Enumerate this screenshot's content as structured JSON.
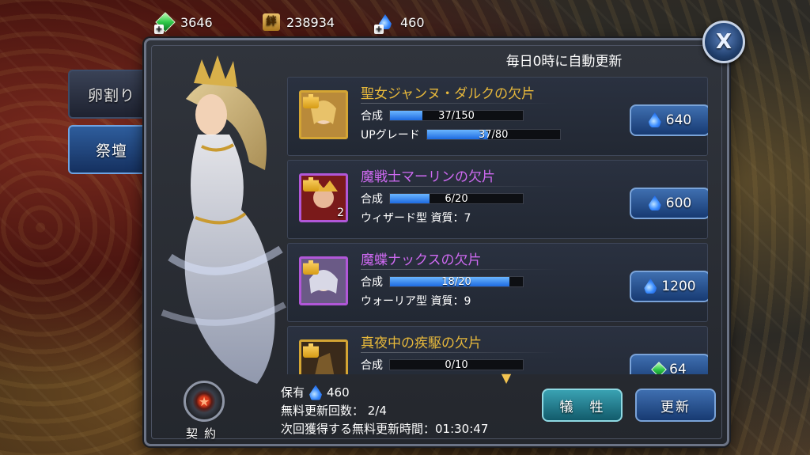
{
  "currencies": {
    "gems": "3646",
    "bond": "238934",
    "bond_icon_text": "絆",
    "drops": "460"
  },
  "tabs": {
    "egg": "卵割り",
    "altar": "祭壇"
  },
  "panel": {
    "title": "毎日0時に自動更新",
    "close_label": "X"
  },
  "items": [
    {
      "name": "聖女ジャンヌ・ダルクの欠片",
      "rarity": "gold",
      "row1_label": "合成",
      "row1_value": "37/150",
      "row1_progress": 0.2467,
      "row2_label": "UPグレード",
      "row2_value": "37/80",
      "row2_progress": 0.4625,
      "price": "640",
      "price_currency": "drop"
    },
    {
      "name": "魔戦士マーリンの欠片",
      "rarity": "purple",
      "thumb_count": "2",
      "row1_label": "合成",
      "row1_value": "6/20",
      "row1_progress": 0.3,
      "row2_text": "ウィザード型 資質：7",
      "price": "600",
      "price_currency": "drop"
    },
    {
      "name": "魔蝶ナックスの欠片",
      "rarity": "purple",
      "row1_label": "合成",
      "row1_value": "18/20",
      "row1_progress": 0.9,
      "row2_text": "ウォーリア型 資質：9",
      "price": "1200",
      "price_currency": "drop"
    },
    {
      "name": "真夜中の疾駆の欠片",
      "rarity": "gold",
      "row1_label": "合成",
      "row1_value": "0/10",
      "row1_progress": 0,
      "price": "64",
      "price_currency": "gem"
    }
  ],
  "footer": {
    "owned_label": "保有",
    "owned_value": "460",
    "free_refresh_line": "無料更新回数： 2/4",
    "next_free_line": "次回獲得する無料更新時間：01:30:47",
    "sacrifice_label": "犠　牲",
    "refresh_label": "更新",
    "contract_label": "契約"
  },
  "colors": {
    "gold_name": "#e8b93b",
    "purple_name": "#cf6af2",
    "progress": "#1d6ae0"
  }
}
